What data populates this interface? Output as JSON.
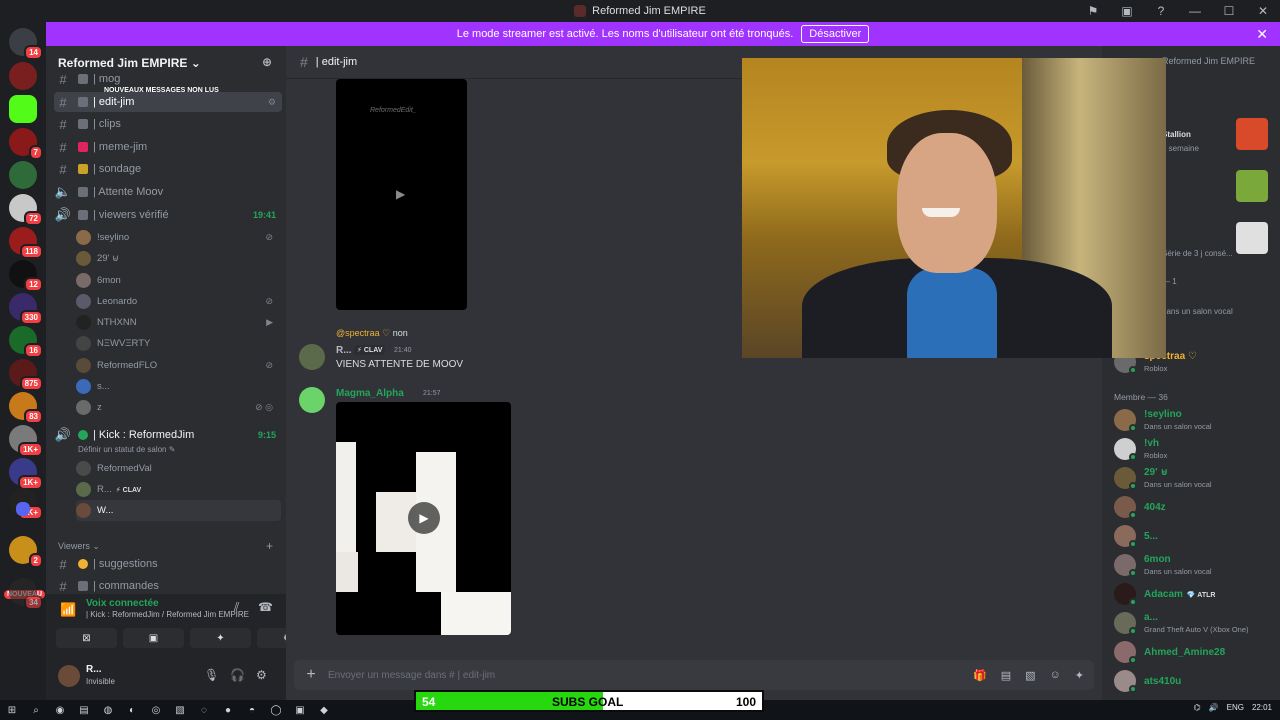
{
  "window": {
    "title": "Reformed Jim EMPIRE"
  },
  "streamer_banner": {
    "text": "Le mode streamer est activé. Les noms d'utilisateur ont été tronqués.",
    "button": "Désactiver"
  },
  "guild_badges": [
    "14",
    "7",
    "72",
    "118",
    "12",
    "330",
    "16",
    "875",
    "83",
    "1K+",
    "1K+",
    "1K+",
    "2",
    "34"
  ],
  "guild_new_label": "NOUVEAU",
  "server": {
    "name": "Reformed Jim EMPIRE ⌄"
  },
  "unread_tag": "NOUVEAUX MESSAGES NON LUS",
  "channels": [
    {
      "label": "| mog",
      "type": "text"
    },
    {
      "label": "| edit-jim",
      "type": "text",
      "active": true
    },
    {
      "label": "| clips",
      "type": "text"
    },
    {
      "label": "| meme-jim",
      "type": "text"
    },
    {
      "label": "| sondage",
      "type": "text"
    },
    {
      "label": "| Attente Moov",
      "type": "voice"
    },
    {
      "label": "| viewers vérifié",
      "type": "voice",
      "time": "19:41"
    }
  ],
  "voice_users_1": [
    "!seylino",
    "29' ⊌",
    "6mon",
    "Leonardo",
    "NTHXNN",
    "NΞWVΞRTY",
    "ReformedFLO",
    "s...",
    "z"
  ],
  "kick_channel": {
    "label": "| Kick : ReformedJim",
    "time": "9:15",
    "status": "Définir un statut de salon ✎"
  },
  "voice_users_2": [
    "ReformedVal",
    "R...",
    "W..."
  ],
  "clav_tag": "⚡ CLAV",
  "viewers_category": "Viewers ⌄",
  "channels_2": [
    "| suggestions",
    "| commandes"
  ],
  "voice_panel": {
    "title": "Voix connectée",
    "path": "| Kick : ReformedJim / Reformed Jim EMPIRE"
  },
  "user_panel": {
    "name": "R...",
    "status": "Invisible"
  },
  "chat": {
    "channel": "| edit-jim",
    "watermark": "ReformedEdit_",
    "reply_to": "@spectraa ♡",
    "reply_text": "non",
    "msg1": {
      "author": "R...",
      "tag": "⚡ CLAV",
      "time": "21:40",
      "text": "VIENS ATTENTE DE MOOV"
    },
    "msg2": {
      "author": "Magma_Alpha",
      "time": "21:57"
    },
    "composer_placeholder": "Envoyer un message dans #    | edit-jim"
  },
  "members": {
    "search": "Reformed Jim EMPIRE",
    "activities": [
      {
        "title": "Stallion",
        "sub": "e semaine"
      },
      {
        "title": "Série de 3 j consé..."
      }
    ],
    "online_count_partial": "— 1",
    "vocal_partial": "dans un salon vocal",
    "top_member": {
      "name": "spectraa ♡",
      "sub": "Roblox"
    },
    "category": "Membre — 36",
    "list": [
      {
        "name": "!seylino",
        "sub": "Dans un salon vocal"
      },
      {
        "name": "!vh",
        "sub": "Roblox"
      },
      {
        "name": "29' ⊌",
        "sub": "Dans un salon vocal"
      },
      {
        "name": "404z",
        "sub": ""
      },
      {
        "name": "5...",
        "sub": ""
      },
      {
        "name": "6mon",
        "sub": "Dans un salon vocal"
      },
      {
        "name": "Adacam",
        "tag": "💎 ATLR",
        "sub": ""
      },
      {
        "name": "a...",
        "sub": "Grand Theft Auto V (Xbox One)"
      },
      {
        "name": "Ahmed_Amine28",
        "sub": ""
      },
      {
        "name": "ats410u",
        "sub": ""
      }
    ]
  },
  "subs_goal": {
    "current": "54",
    "title": "SUBS GOAL",
    "target": "100",
    "progress": 0.54
  },
  "tray": {
    "lang": "ENG",
    "time": "22:01"
  },
  "colors": {
    "accent": "#a033ff",
    "online": "#23a55a",
    "goal": "#28d80f"
  }
}
